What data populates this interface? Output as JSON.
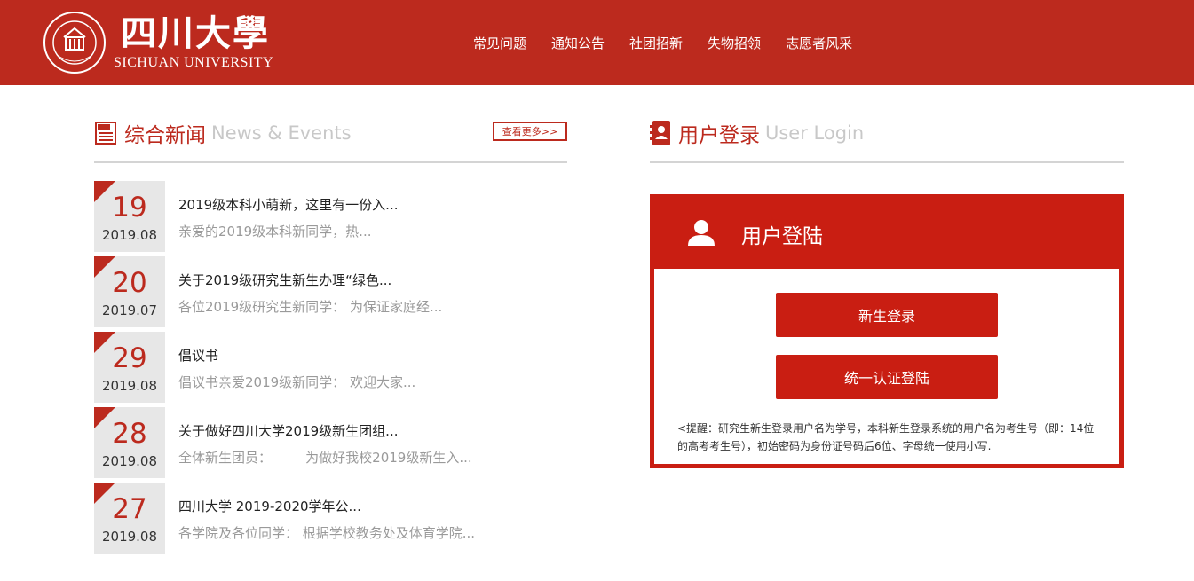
{
  "header": {
    "logo_cn": "四川大學",
    "logo_en": "SICHUAN UNIVERSITY",
    "nav": [
      "常见问题",
      "通知公告",
      "社团招新",
      "失物招领",
      "志愿者风采"
    ]
  },
  "news": {
    "title_cn": "综合新闻",
    "title_en": "News & Events",
    "more_label": "查看更多>>",
    "items": [
      {
        "day": "19",
        "ym": "2019.08",
        "title": "2019级本科小萌新，这里有一份入...",
        "summary": "亲爱的2019级本科新同学，热..."
      },
      {
        "day": "20",
        "ym": "2019.07",
        "title": "关于2019级研究生新生办理“绿色...",
        "summary": "各位2019级研究生新同学： 为保证家庭经..."
      },
      {
        "day": "29",
        "ym": "2019.08",
        "title": "倡议书",
        "summary": "倡议书亲爱2019级新同学： 欢迎大家..."
      },
      {
        "day": "28",
        "ym": "2019.08",
        "title": "关于做好四川大学2019级新生团组...",
        "summary": "全体新生团员：        为做好我校2019级新生入..."
      },
      {
        "day": "27",
        "ym": "2019.08",
        "title": "四川大学 2019-2020学年公...",
        "summary": "各学院及各位同学： 根据学校教务处及体育学院..."
      }
    ]
  },
  "login": {
    "title_cn": "用户登录",
    "title_en": "User Login",
    "panel_title": "用户登陆",
    "btn_new": "新生登录",
    "btn_unified": "统一认证登陆",
    "notice": "<提醒：研究生新生登录用户名为学号，本科新生登录系统的用户名为考生号（即：14位的高考考生号），初始密码为身份证号码后6位、字母统一使用小写."
  },
  "colors": {
    "brand": "#bc2a1e",
    "panel": "#c91e12"
  }
}
